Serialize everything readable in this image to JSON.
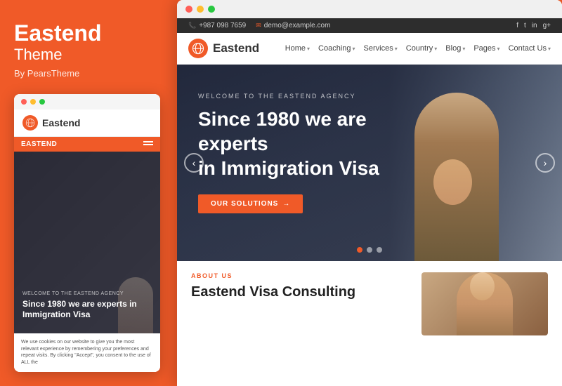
{
  "left": {
    "brand": {
      "name": "Eastend",
      "subtitle": "Theme",
      "by": "By PearsTheme"
    },
    "mini_browser": {
      "logo": "Eastend",
      "nav_brand": "EASTEND",
      "welcome": "WELCOME TO THE EASTEND AGENCY",
      "headline": "Since 1980 we are experts in Immigration Visa",
      "cookie_text": "We use cookies on our website to give you the most relevant experience by remembering your preferences and repeat visits. By clicking \"Accept\", you consent to the use of ALL the"
    }
  },
  "right": {
    "top_bar": {
      "phone": "+987 098 7659",
      "email": "demo@example.com",
      "social": [
        "f",
        "t",
        "in",
        "g+"
      ]
    },
    "nav": {
      "logo": "Eastend",
      "items": [
        {
          "label": "Home",
          "has_dropdown": true
        },
        {
          "label": "Coaching",
          "has_dropdown": true
        },
        {
          "label": "Services",
          "has_dropdown": true
        },
        {
          "label": "Country",
          "has_dropdown": true
        },
        {
          "label": "Blog",
          "has_dropdown": true
        },
        {
          "label": "Pages",
          "has_dropdown": true
        },
        {
          "label": "Contact Us",
          "has_dropdown": true
        }
      ]
    },
    "hero": {
      "welcome": "WELCOME TO THE EASTEND AGENCY",
      "headline_line1": "Since 1980 we are experts",
      "headline_line2": "in Immigration Visa",
      "cta": "OUR SOLUTIONS",
      "dots": [
        true,
        false,
        false
      ],
      "arrow_left": "‹",
      "arrow_right": "›"
    },
    "about": {
      "tag": "ABOUT US",
      "title": "Eastend Visa Consulting"
    }
  }
}
